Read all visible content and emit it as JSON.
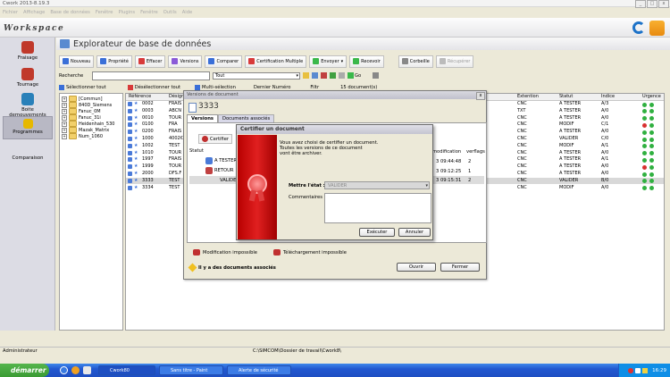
{
  "app": {
    "title": "Cwork 2013-8.19.3",
    "menu": [
      "Fichier",
      "Affichage",
      "Base de données",
      "Fenêtre",
      "Plugins",
      "Fenêtre",
      "Outils",
      "Aide"
    ],
    "window_controls": [
      "_",
      "□",
      "x"
    ]
  },
  "workspace": {
    "title": "Workspace"
  },
  "sidebar": {
    "items": [
      {
        "label": "Fraisage",
        "icon": "milling-icon",
        "color": "#c0392b"
      },
      {
        "label": "Tournage",
        "icon": "turning-icon",
        "color": "#c0392b"
      },
      {
        "label": "Boite demouvements",
        "icon": "movements-icon",
        "color": "#2980b9"
      },
      {
        "label": "Programmes",
        "icon": "programs-icon",
        "color": "#e6b800"
      },
      {
        "label": "Comparaison",
        "icon": "compare-icon",
        "color": "#888888"
      }
    ]
  },
  "main": {
    "title": "Explorateur de base de données",
    "toolbar1": [
      {
        "label": "Nouveau",
        "icon": "new-icon",
        "color": "#3a6fd8"
      },
      {
        "label": "Propriété",
        "icon": "properties-icon",
        "color": "#3a6fd8"
      },
      {
        "label": "Effacer",
        "icon": "delete-icon",
        "color": "#d83a3a"
      },
      {
        "label": "Versions",
        "icon": "versions-icon",
        "color": "#8a5ad8"
      },
      {
        "label": "Comparer",
        "icon": "compare-icon",
        "color": "#3a6fd8"
      },
      {
        "label": "Certification Multiple",
        "icon": "certify-icon",
        "color": "#d83a3a"
      },
      {
        "label": "Envoyer",
        "icon": "send-icon",
        "color": "#3ab84a"
      },
      {
        "label": "Recevoir",
        "icon": "receive-icon",
        "color": "#3ab84a"
      },
      {
        "label": "Corbeille",
        "icon": "trash-icon",
        "color": "#888888"
      },
      {
        "label": "Récupérer",
        "icon": "recover-icon",
        "color": "#aaaaaa"
      }
    ],
    "search": {
      "label": "Recherche",
      "value": "",
      "filter_value": "Tout",
      "go_label": "Go"
    },
    "toolbar3": [
      {
        "label": "Sélectionner tout"
      },
      {
        "label": "Désélectionner tout"
      },
      {
        "label": "Multi-sélection"
      },
      {
        "label": "Dernier Numéro"
      },
      {
        "label": "Filtr"
      },
      {
        "label": "15 document(s)"
      }
    ]
  },
  "tree": {
    "items": [
      {
        "label": "[Commun]"
      },
      {
        "label": "840D_Siemens"
      },
      {
        "label": "Fanuc_0M"
      },
      {
        "label": "Fanuc_31i"
      },
      {
        "label": "Heidenhain_530"
      },
      {
        "label": "Mazak_Matrix"
      },
      {
        "label": "Num_1060"
      }
    ]
  },
  "grid": {
    "headers": {
      "ref": "Référence",
      "desig": "Désign",
      "ext": "Extention",
      "statut": "Statut",
      "indice": "Indice",
      "urgence": "Urgence"
    },
    "rows": [
      {
        "ref": "0002",
        "desig": "FRAIS",
        "ext": "CNC",
        "statut": "A TESTER",
        "indice": "A/3",
        "urg": "green"
      },
      {
        "ref": "0003",
        "desig": "ABCN",
        "ext": "TXT",
        "statut": "A TESTER",
        "indice": "A/0",
        "urg": "green"
      },
      {
        "ref": "0010",
        "desig": "TOUR",
        "ext": "CNC",
        "statut": "A TESTER",
        "indice": "A/0",
        "urg": "green"
      },
      {
        "ref": "0100",
        "desig": "FRA",
        "ext": "CNC",
        "statut": "MODIF",
        "indice": "C/1",
        "urg": "red"
      },
      {
        "ref": "0200",
        "desig": "FRAIS",
        "ext": "CNC",
        "statut": "A TESTER",
        "indice": "A/0",
        "urg": "green"
      },
      {
        "ref": "1000",
        "desig": "4002€",
        "ext": "CNC",
        "statut": "VALIDER",
        "indice": "C/0",
        "urg": "green"
      },
      {
        "ref": "1002",
        "desig": "TEST",
        "ext": "CNC",
        "statut": "MODIF",
        "indice": "A/1",
        "urg": "green"
      },
      {
        "ref": "1010",
        "desig": "TOUR",
        "ext": "CNC",
        "statut": "A TESTER",
        "indice": "A/0",
        "urg": "green"
      },
      {
        "ref": "1997",
        "desig": "FRAIS",
        "ext": "CNC",
        "statut": "A TESTER",
        "indice": "A/1",
        "urg": "green"
      },
      {
        "ref": "1999",
        "desig": "TOUR",
        "ext": "CNC",
        "statut": "A TESTER",
        "indice": "A/0",
        "urg": "red"
      },
      {
        "ref": "2000",
        "desig": "DFS.F",
        "ext": "CNC",
        "statut": "A TESTER",
        "indice": "A/0",
        "urg": "green"
      },
      {
        "ref": "3333",
        "desig": "TEST",
        "ext": "CNC",
        "statut": "VALIDER",
        "indice": "B/0",
        "urg": "green"
      },
      {
        "ref": "3334",
        "desig": "TEST",
        "ext": "CNC",
        "statut": "MODIF",
        "indice": "A/0",
        "urg": "green"
      }
    ]
  },
  "dlg1": {
    "title": "Versions de document",
    "doc_number": "3333",
    "tabs": [
      "Versions",
      "Documents associés"
    ],
    "certify_label": "Certifier",
    "status_header": "Statut",
    "status_items": [
      "A TESTER",
      "RETOUR",
      "VALIDER"
    ],
    "col_modif": "modification",
    "col_verflags": "verflags",
    "dates": [
      "3 09:44:48",
      "3 09:12:25",
      "3 09:15:31"
    ],
    "counts": [
      "2",
      "1",
      "2"
    ],
    "warnings": [
      "Modification impossible",
      "Téléchargement impossible"
    ],
    "info": "Il y a des documents associés",
    "open_label": "Ouvrir",
    "close_label": "Fermer"
  },
  "dlg2": {
    "title": "Certifier un document",
    "message_lines": [
      "Vous avez choisi de certifier un document.",
      "Toutes les versions de ce document",
      "vont être archiver."
    ],
    "state_label": "Mettre l'état :",
    "state_value": "VALIDER",
    "comments_label": "Commentaires :",
    "comments_value": "",
    "execute_label": "Exécuter",
    "cancel_label": "Annuler"
  },
  "status": {
    "user": "Administrateur",
    "path": "C:\\SIMCOM\\Dossier de travail\\Cwork8\\"
  },
  "taskbar": {
    "start_label": "démarrer",
    "tasks": [
      "Cwork80",
      "Sans titre - Paint",
      "Alerte de sécurité"
    ],
    "clock": "16:29"
  }
}
